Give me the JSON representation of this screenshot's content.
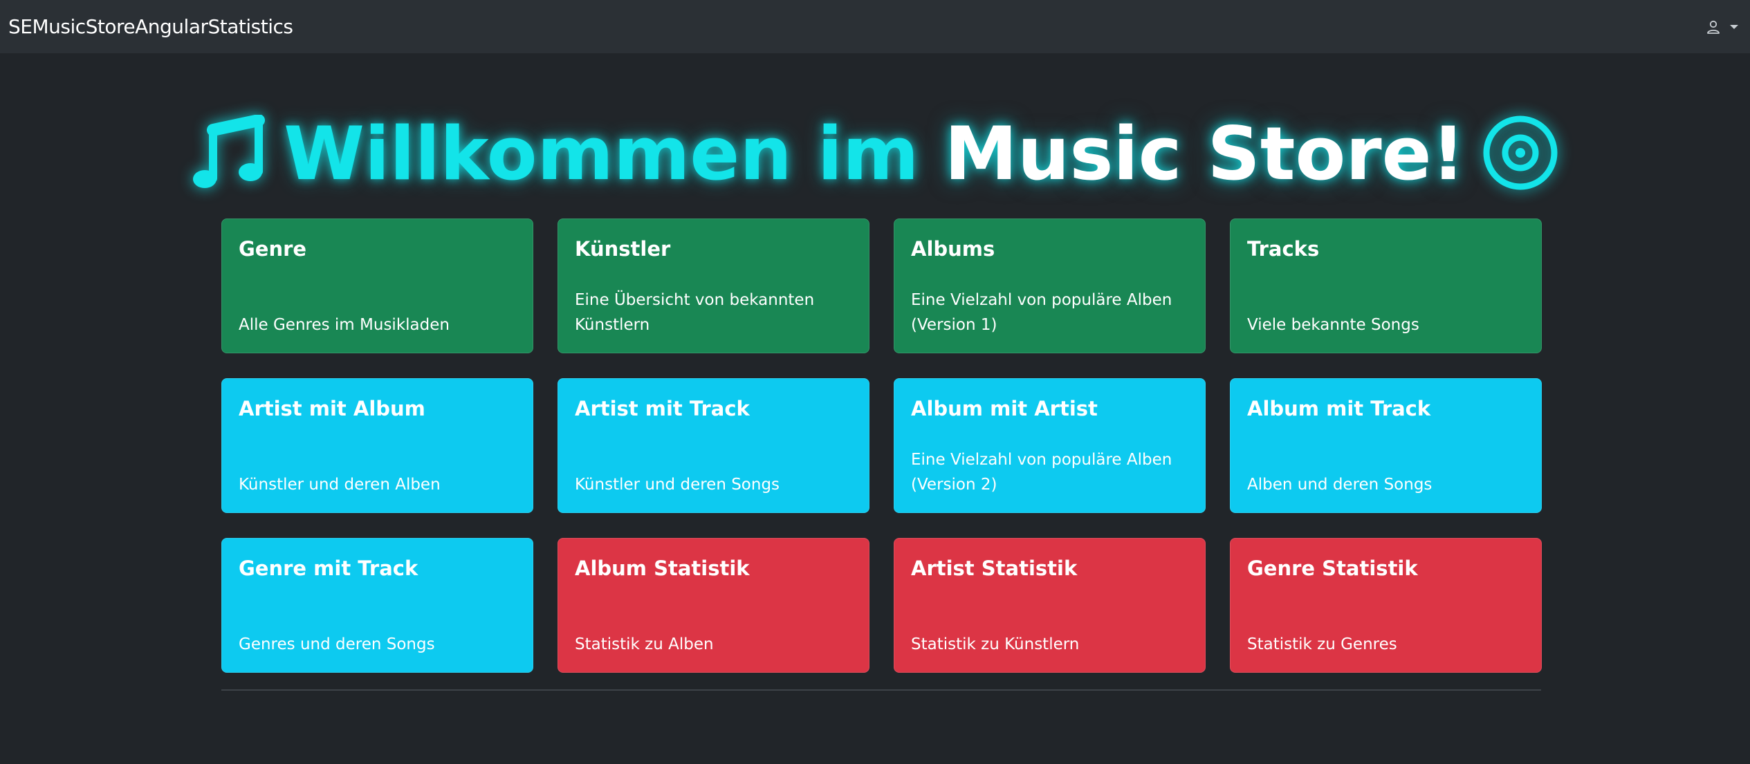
{
  "navbar": {
    "brand": "SEMusicStoreAngularStatistics",
    "user_icon": "user-icon",
    "caret_icon": "caret-down-icon"
  },
  "hero": {
    "title_accent": "Willkommen im",
    "title_plain": "Music Store!",
    "left_icon": "music-note-icon",
    "right_icon": "vinyl-disc-icon",
    "glow_color": "#13e4e9"
  },
  "colors": {
    "background": "#212529",
    "navbar": "#2b3035",
    "green": "#198754",
    "cyan": "#0dcaf0",
    "red": "#dc3545"
  },
  "cards": [
    {
      "title": "Genre",
      "text": "Alle Genres im Musikladen",
      "color": "green"
    },
    {
      "title": "Künstler",
      "text": "Eine Übersicht von bekannten Künstlern",
      "color": "green"
    },
    {
      "title": "Albums",
      "text": "Eine Vielzahl von populäre Alben (Version 1)",
      "color": "green"
    },
    {
      "title": "Tracks",
      "text": "Viele bekannte Songs",
      "color": "green"
    },
    {
      "title": "Artist mit Album",
      "text": "Künstler und deren Alben",
      "color": "cyan"
    },
    {
      "title": "Artist mit Track",
      "text": "Künstler und deren Songs",
      "color": "cyan"
    },
    {
      "title": "Album mit Artist",
      "text": "Eine Vielzahl von populäre Alben (Version 2)",
      "color": "cyan"
    },
    {
      "title": "Album mit Track",
      "text": "Alben und deren Songs",
      "color": "cyan"
    },
    {
      "title": "Genre mit Track",
      "text": "Genres und deren Songs",
      "color": "cyan"
    },
    {
      "title": "Album Statistik",
      "text": "Statistik zu Alben",
      "color": "red"
    },
    {
      "title": "Artist Statistik",
      "text": "Statistik zu Künstlern",
      "color": "red"
    },
    {
      "title": "Genre Statistik",
      "text": "Statistik zu Genres",
      "color": "red"
    }
  ]
}
